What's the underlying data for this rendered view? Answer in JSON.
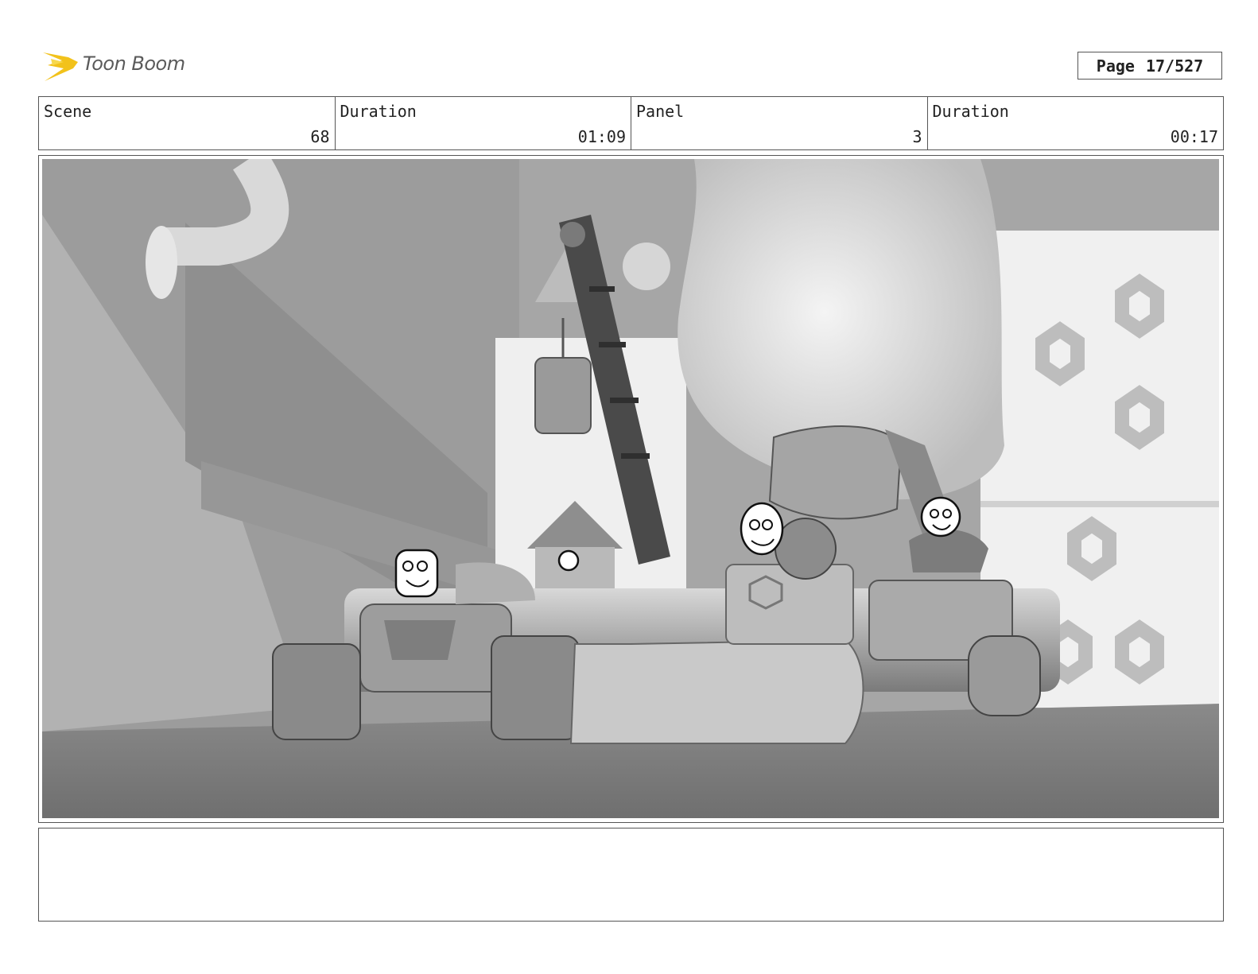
{
  "header": {
    "logo": {
      "text": "Toon Boom",
      "accent_color": "#f2c21b"
    },
    "page": {
      "label": "Page",
      "value": "17/527"
    }
  },
  "info": {
    "scene": {
      "label": "Scene",
      "value": "68"
    },
    "scene_duration": {
      "label": "Duration",
      "value": "01:09"
    },
    "panel": {
      "label": "Panel",
      "value": "3"
    },
    "panel_duration": {
      "label": "Duration",
      "value": "00:17"
    }
  },
  "notes": {
    "text": ""
  }
}
